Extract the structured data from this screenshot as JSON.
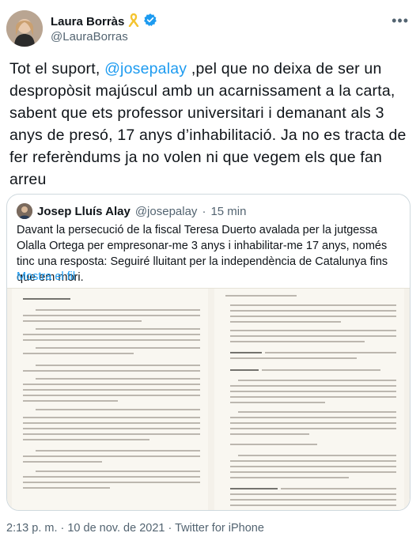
{
  "tweet": {
    "author_name": "Laura Borràs",
    "author_handle": "@LauraBorras",
    "text_parts": [
      "Tot el suport, ",
      "@josepalay",
      " ,pel que no deixa de ser un despropòsit majúscul amb un acarnissament a la carta, sabent que ets professor universitari i demanant als 3 anys de presó, 17 anys d’inhabilitació. Ja no es tracta de fer referèndums ja no volen ni que vegem els que fan arreu"
    ],
    "timestamp": "2:13 p. m. · 10 de nov. de 2021 · Twitter for iPhone"
  },
  "quote": {
    "author_name": "Josep Lluís Alay",
    "author_handle": "@josepalay",
    "separator": "·",
    "age": "15 min",
    "text": "Davant la persecució de la fiscal Teresa Duerto avalada per la jutgessa Olalla Ortega per empresonar-me 3 anys i inhabilitar-me 17 anys, només tinc una resposta: Seguiré lluitant per la independència de Catalunya fins que em mori.",
    "show_more": "Mostra el fil"
  },
  "icons": {
    "ribbon": "yellow-ribbon-icon",
    "verified": "verified-badge-icon",
    "more": "more-options-icon"
  },
  "colors": {
    "accent": "#1d9bf0",
    "muted": "#536471",
    "ribbon": "#f4c430"
  }
}
